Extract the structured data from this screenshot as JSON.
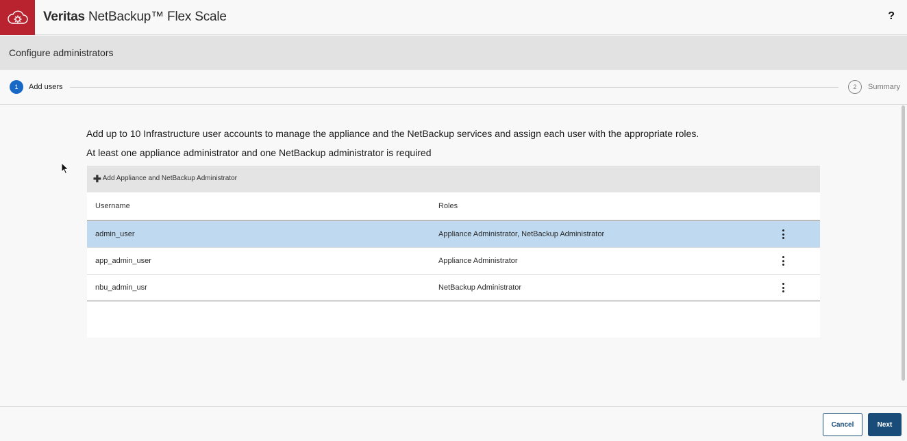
{
  "header": {
    "brand": "Veritas",
    "product": "NetBackup™ Flex Scale",
    "help_label": "?",
    "logo_icon": "cloud-gear-icon",
    "brand_color": "#b8232f"
  },
  "page": {
    "title": "Configure administrators"
  },
  "stepper": {
    "steps": [
      {
        "number": "1",
        "label": "Add users",
        "state": "active"
      },
      {
        "number": "2",
        "label": "Summary",
        "state": "pending"
      }
    ],
    "active_color": "#1769c5"
  },
  "intro": {
    "line1": "Add up to 10 Infrastructure user accounts to manage the appliance and the NetBackup services and assign each user with the appropriate roles.",
    "line2": "At least one appliance administrator and one NetBackup administrator is required"
  },
  "grid": {
    "add_button_label": "Add Appliance and NetBackup Administrator",
    "columns": {
      "username": "Username",
      "roles": "Roles"
    },
    "rows": [
      {
        "username": "admin_user",
        "roles": "Appliance Administrator, NetBackup Administrator",
        "selected": true
      },
      {
        "username": "app_admin_user",
        "roles": "Appliance Administrator",
        "selected": false
      },
      {
        "username": "nbu_admin_usr",
        "roles": "NetBackup Administrator",
        "selected": false
      }
    ],
    "selected_row_color": "#bfdaf0"
  },
  "footer": {
    "cancel_label": "Cancel",
    "next_label": "Next",
    "primary_color": "#1a4c7a"
  }
}
